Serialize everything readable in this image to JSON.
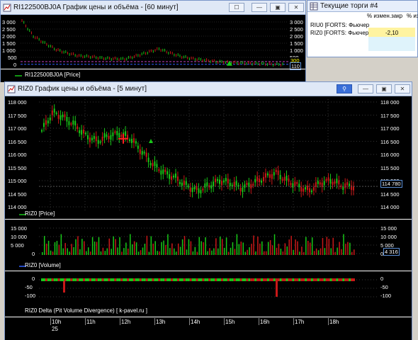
{
  "window1": {
    "title": "RI122500BJ0A График цены и объёма - [60 минут]",
    "legend": "RI122500BJ0A [Price]",
    "yticks": [
      "3 000",
      "2 500",
      "2 000",
      "1 500",
      "1 000",
      "500",
      "0"
    ],
    "yticks_right": [
      "3 000",
      "2 500",
      "2 000",
      "1 500",
      "1 000",
      "500",
      "0"
    ],
    "last_value_a": "300",
    "last_value_b": "110",
    "colors": {
      "up": "#18c818",
      "down": "#c81818",
      "level": "#c040c0"
    }
  },
  "window2": {
    "title": "RIZ0 График цены и объёма - [5 минут]",
    "price_pane": {
      "legend": "RIZ0 [Price]",
      "yticks": [
        "118 000",
        "117 500",
        "117 000",
        "116 500",
        "116 000",
        "115 500",
        "115 000",
        "114 500",
        "114 000"
      ],
      "yticks_right": [
        "118 000",
        "117 500",
        "117 000",
        "116 500",
        "116 000",
        "115 500",
        "115 000",
        "114 500",
        "114 000"
      ],
      "last_price": "114 780"
    },
    "volume_pane": {
      "legend": "RIZ0 [Volume]",
      "yticks": [
        "15 000",
        "10 000",
        "5 000",
        "0"
      ],
      "yticks_right": [
        "15 000",
        "10 000",
        "5 000",
        "0"
      ],
      "last_volume": "4 316"
    },
    "delta_pane": {
      "legend": "RIZ0 Delta (Pit Volume Divergence) [ k-pavel.ru ]",
      "yticks": [
        "0",
        "-50",
        "-100"
      ],
      "yticks_right": [
        "0",
        "-50",
        "-100"
      ]
    },
    "time_axis": {
      "hours": [
        "10h",
        "11h",
        "12h",
        "13h",
        "14h",
        "15h",
        "16h",
        "17h",
        "18h"
      ],
      "day": "25"
    }
  },
  "trades": {
    "title": "Текущие торги #4",
    "columns": [
      "% измен.закр",
      "% из"
    ],
    "rows": [
      {
        "name": "RIU0 [FORTS: Фьючер",
        "change": ""
      },
      {
        "name": "RIZ0 [FORTS: Фьючер",
        "change": "-2,10"
      }
    ]
  },
  "chart_data": [
    {
      "type": "line",
      "title": "RI122500BJ0A График цены и объёма - [60 минут]",
      "series": [
        {
          "name": "RI122500BJ0A [Price]",
          "values": [
            3200,
            2100,
            1600,
            1150,
            900,
            700,
            650,
            550,
            500,
            480,
            700,
            950,
            1200,
            900,
            650,
            500,
            400,
            300,
            250,
            200,
            180,
            150,
            110
          ]
        }
      ],
      "ylim": [
        0,
        3200
      ]
    },
    {
      "type": "line",
      "title": "RIZ0 График цены и объёма - [5 минут]",
      "series": [
        {
          "name": "RIZ0 [Price]",
          "values": [
            116900,
            117600,
            117400,
            117100,
            116700,
            116500,
            116700,
            116800,
            116600,
            116100,
            115600,
            115300,
            115100,
            114800,
            114600,
            114800,
            115000,
            114900,
            114700,
            114900,
            115100,
            115300,
            115000,
            114800,
            114600,
            114900,
            115000,
            114800,
            114780
          ]
        }
      ],
      "x": [
        "10h",
        "11h",
        "12h",
        "13h",
        "14h",
        "15h",
        "16h",
        "17h",
        "18h"
      ],
      "ylim": [
        114000,
        118000
      ]
    }
  ]
}
